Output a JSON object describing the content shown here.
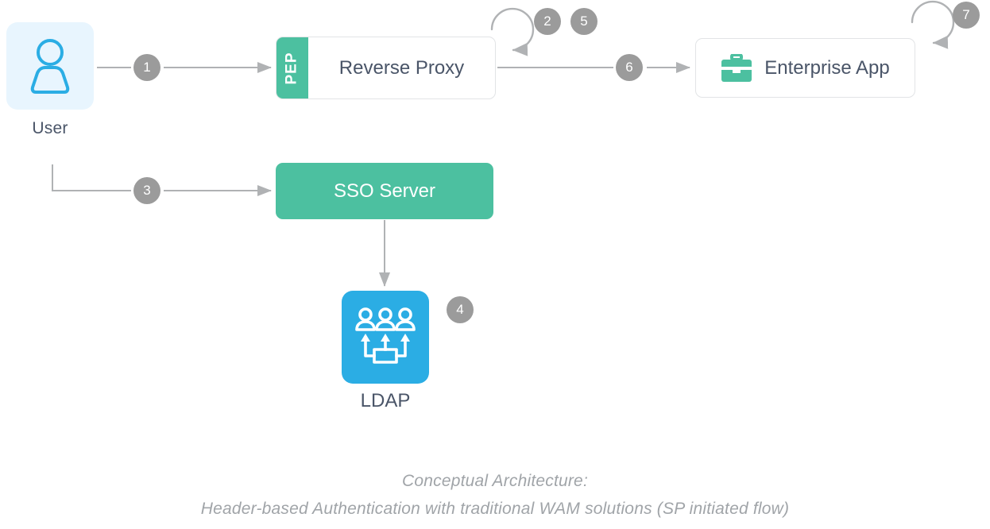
{
  "diagram": {
    "title_line_1": "Conceptual Architecture:",
    "title_line_2": "Header-based Authentication with traditional WAM solutions (SP initiated flow)",
    "colors": {
      "green": "#4cc0a0",
      "blue": "#2bade4",
      "user_tile_bg": "#e8f5fe",
      "badge_gray": "#9b9b9b",
      "text_dark": "#4a5568",
      "connector_gray": "#b0b2b4",
      "caption_gray": "#a0a4a8",
      "box_border": "#e2e4e6"
    }
  },
  "nodes": {
    "user": {
      "label": "User",
      "icon": "user-icon"
    },
    "reverse_proxy": {
      "label": "Reverse Proxy",
      "band_label": "PEP"
    },
    "enterprise_app": {
      "label": "Enterprise App",
      "icon": "briefcase-icon"
    },
    "sso_server": {
      "label": "SSO Server"
    },
    "ldap": {
      "label": "LDAP",
      "icon": "ldap-directory-icon"
    }
  },
  "steps": [
    {
      "number": "1",
      "from": "user",
      "to": "reverse_proxy",
      "kind": "arrow"
    },
    {
      "number": "2",
      "from": "reverse_proxy",
      "to": "reverse_proxy",
      "kind": "loop"
    },
    {
      "number": "3",
      "from": "user",
      "to": "sso_server",
      "kind": "arrow"
    },
    {
      "number": "4",
      "from": "sso_server",
      "to": "ldap",
      "kind": "arrow"
    },
    {
      "number": "5",
      "from": "reverse_proxy",
      "to": "reverse_proxy",
      "kind": "loop"
    },
    {
      "number": "6",
      "from": "reverse_proxy",
      "to": "enterprise_app",
      "kind": "arrow"
    },
    {
      "number": "7",
      "from": "enterprise_app",
      "to": "enterprise_app",
      "kind": "loop"
    }
  ]
}
